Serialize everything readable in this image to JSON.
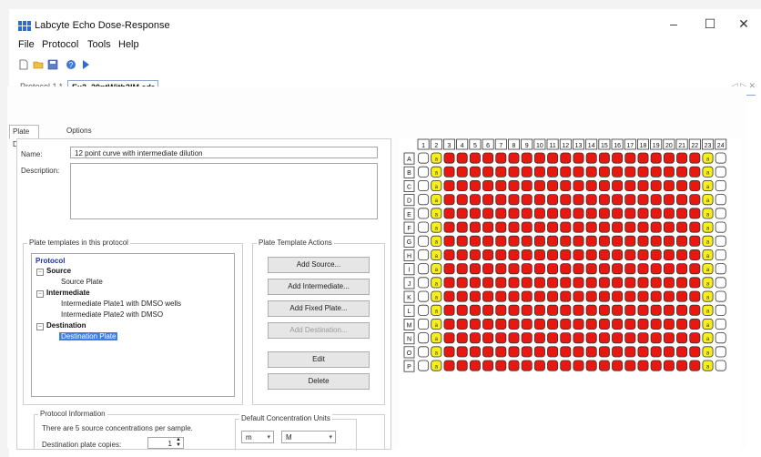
{
  "window": {
    "title": "Labcyte Echo Dose-Response",
    "controls": {
      "minimize": "–",
      "maximize": "☐",
      "close": "✕"
    }
  },
  "menu": [
    "File",
    "Protocol",
    "Tools",
    "Help"
  ],
  "toolbar_icons": [
    "new-icon",
    "open-icon",
    "save-icon",
    "help-icon",
    "run-icon"
  ],
  "doc_tabs": [
    {
      "label": "Protocol 1 *",
      "active": false
    },
    {
      "label": "Ex2_20ptWith2IM.edr",
      "active": true
    }
  ],
  "doc_tab_nav": "◁ ▷ ✕",
  "inner_tabs": [
    {
      "label": "Plate Design",
      "active": true
    },
    {
      "label": "Options",
      "active": false
    }
  ],
  "form": {
    "name_label": "Name:",
    "name_value": "12 point curve with intermediate dilution",
    "description_label": "Description:",
    "description_value": ""
  },
  "templates_group": {
    "title": "Plate templates in this protocol",
    "tree": {
      "root": "Protocol",
      "source": "Source",
      "source_plate": "Source Plate",
      "intermediate": "Intermediate",
      "intermediate_1": "Intermediate Plate1 with DMSO wells",
      "intermediate_2": "Intermediate Plate2 with DMSO",
      "destination": "Destination",
      "destination_plate": "Destination Plate"
    }
  },
  "actions_group": {
    "title": "Plate Template Actions",
    "buttons": [
      {
        "label": "Add Source...",
        "enabled": true
      },
      {
        "label": "Add Intermediate...",
        "enabled": true
      },
      {
        "label": "Add Fixed Plate...",
        "enabled": true
      },
      {
        "label": "Add Destination...",
        "enabled": false
      },
      {
        "label": "Edit",
        "enabled": true
      },
      {
        "label": "Delete",
        "enabled": true
      }
    ]
  },
  "protocol_info": {
    "title": "Protocol Information",
    "source_text": "There are 5 source concentrations per sample.",
    "copies_label": "Destination plate copies:",
    "copies_value": "1"
  },
  "conc_units": {
    "title": "Default Concentration Units",
    "prefix": "m",
    "unit": "M"
  },
  "plate": {
    "columns": [
      "1",
      "2",
      "3",
      "4",
      "5",
      "6",
      "7",
      "8",
      "9",
      "10",
      "11",
      "12",
      "13",
      "14",
      "15",
      "16",
      "17",
      "18",
      "19",
      "20",
      "21",
      "22",
      "23",
      "24"
    ],
    "rows": [
      "A",
      "B",
      "C",
      "D",
      "E",
      "F",
      "G",
      "H",
      "I",
      "J",
      "K",
      "L",
      "M",
      "N",
      "O",
      "P"
    ],
    "control_label": "a",
    "colors": {
      "sample": "#e8170f",
      "control": "#f7ef1c",
      "empty": "#ffffff",
      "border": "#333333"
    },
    "column_types": [
      "empty",
      "control",
      "sample",
      "sample",
      "sample",
      "sample",
      "sample",
      "sample",
      "sample",
      "sample",
      "sample",
      "sample",
      "sample",
      "sample",
      "sample",
      "sample",
      "sample",
      "sample",
      "sample",
      "sample",
      "sample",
      "sample",
      "control",
      "empty"
    ]
  }
}
